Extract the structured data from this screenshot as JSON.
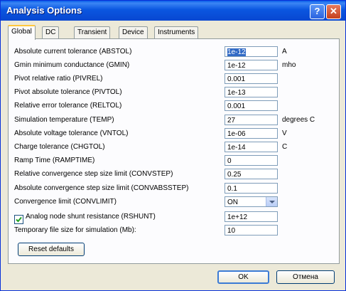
{
  "window": {
    "title": "Analysis Options",
    "help_label": "?",
    "close_label": "✕"
  },
  "tabs": [
    "Global",
    "DC",
    "Transient",
    "Device",
    "Instruments"
  ],
  "rows": [
    {
      "label": "Absolute current tolerance (ABSTOL)",
      "value": "1e-12",
      "unit": "A"
    },
    {
      "label": "Gmin minimum conductance (GMIN)",
      "value": "1e-12",
      "unit": "mho"
    },
    {
      "label": "Pivot relative ratio (PIVREL)",
      "value": "0.001",
      "unit": ""
    },
    {
      "label": "Pivot absolute tolerance (PIVTOL)",
      "value": "1e-13",
      "unit": ""
    },
    {
      "label": "Relative error tolerance (RELTOL)",
      "value": "0.001",
      "unit": ""
    },
    {
      "label": "Simulation temperature (TEMP)",
      "value": "27",
      "unit": "degrees C"
    },
    {
      "label": "Absolute voltage tolerance (VNTOL)",
      "value": "1e-06",
      "unit": "V"
    },
    {
      "label": "Charge tolerance (CHGTOL)",
      "value": "1e-14",
      "unit": "C"
    },
    {
      "label": "Ramp Time (RAMPTIME)",
      "value": "0",
      "unit": ""
    },
    {
      "label": "Relative convergence step size limit (CONVSTEP)",
      "value": "0.25",
      "unit": ""
    },
    {
      "label": "Absolute convergence step size limit (CONVABSSTEP)",
      "value": "0.1",
      "unit": ""
    },
    {
      "label": "Convergence limit (CONVLIMIT)",
      "value": "ON",
      "unit": ""
    },
    {
      "label": "Analog node shunt resistance (RSHUNT)",
      "value": "1e+12",
      "unit": ""
    },
    {
      "label": "Temporary file size for simulation (Mb):",
      "value": "10",
      "unit": ""
    }
  ],
  "rshunt_checked": true,
  "buttons": {
    "reset": "Reset defaults",
    "ok": "OK",
    "cancel": "Отмена"
  }
}
